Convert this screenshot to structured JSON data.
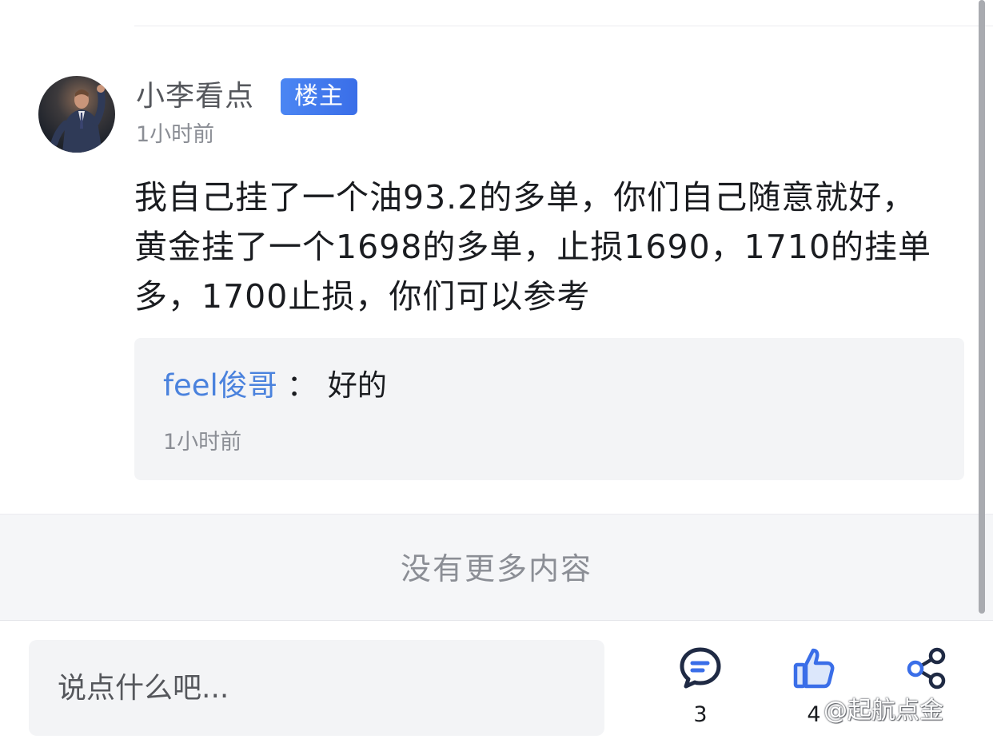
{
  "post": {
    "author": "小李看点",
    "badge": "楼主",
    "time": "1小时前",
    "body": "我自己挂了一个油93.2的多单，你们自己随意就好，黄金挂了一个1698的多单，止损1690，1710的挂单多，1700止损，你们可以参考"
  },
  "reply": {
    "author": "feel俊哥",
    "separator": "：",
    "text": "好的",
    "time": "1小时前"
  },
  "end_message": "没有更多内容",
  "bottom_bar": {
    "input_placeholder": "说点什么吧...",
    "comment_count": "3",
    "like_count": "4",
    "icons": {
      "comment": "comment-bubble-icon",
      "like": "thumbs-up-icon",
      "share": "share-icon"
    },
    "accent_color": "#3a6ee8"
  },
  "watermark": "@起航点金"
}
